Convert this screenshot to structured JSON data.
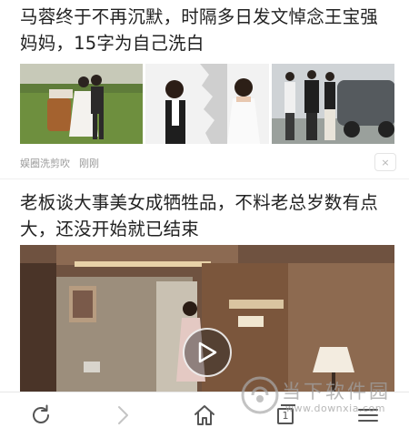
{
  "feed": {
    "article1": {
      "title": "马蓉终于不再沉默，时隔多日发文悼念王宝强妈妈，15字为自己洗白",
      "source": "娱圈洗剪吹",
      "time": "刚刚",
      "dismiss": "×"
    },
    "article2": {
      "title": "老板谈大事美女成牺牲品，不料老总岁数有点大，还没开始就已结束"
    }
  },
  "toolbar": {
    "items": [
      {
        "name": "refresh-icon"
      },
      {
        "name": "forward-icon"
      },
      {
        "name": "home-icon"
      },
      {
        "name": "tabs-icon",
        "count": "1"
      },
      {
        "name": "menu-icon"
      }
    ]
  },
  "watermark": {
    "title": "当下软件园",
    "url": "www.downxia.com"
  },
  "colors": {
    "text": "#222222",
    "meta": "#9a9a9a",
    "icon": "#555555"
  }
}
